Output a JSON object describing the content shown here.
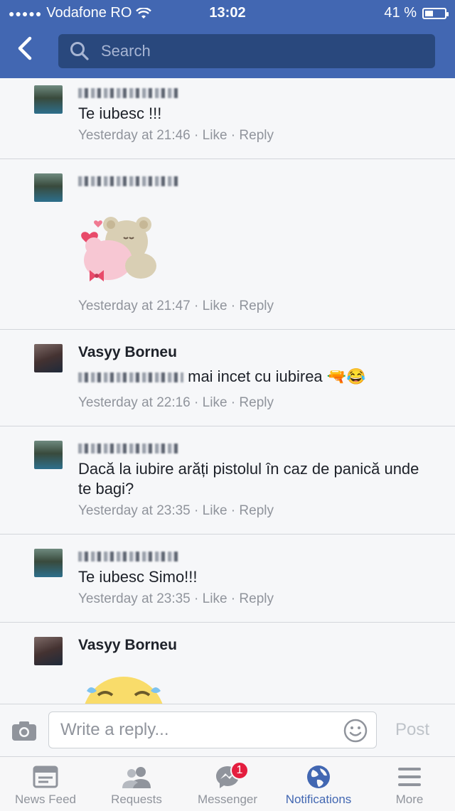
{
  "status": {
    "carrier": "Vodafone RO",
    "time": "13:02",
    "battery": "41 %",
    "battery_level": 0.41
  },
  "header": {
    "search_placeholder": "Search"
  },
  "comments": [
    {
      "author": "",
      "text": "Te iubesc !!!",
      "time": "Yesterday at 21:46",
      "like": "Like",
      "reply": "Reply"
    },
    {
      "author": "",
      "text": "",
      "time": "Yesterday at 21:47",
      "like": "Like",
      "reply": "Reply"
    },
    {
      "author": "Vasyy Borneu",
      "mention": "",
      "text": "mai incet cu iubirea",
      "emojis": "🔫😂",
      "time": "Yesterday at 22:16",
      "like": "Like",
      "reply": "Reply"
    },
    {
      "author": "",
      "text": "Dacă la iubire arăți pistolul în caz de panică unde te bagi?",
      "time": "Yesterday at 23:35",
      "like": "Like",
      "reply": "Reply"
    },
    {
      "author": "",
      "text": "Te iubesc Simo!!!",
      "time": "Yesterday at 23:35",
      "like": "Like",
      "reply": "Reply"
    },
    {
      "author": "Vasyy Borneu"
    }
  ],
  "reply_bar": {
    "placeholder": "Write a reply...",
    "post_label": "Post"
  },
  "tabs": [
    {
      "label": "News Feed",
      "icon": "news-feed-icon"
    },
    {
      "label": "Requests",
      "icon": "requests-icon"
    },
    {
      "label": "Messenger",
      "icon": "messenger-icon",
      "badge": "1"
    },
    {
      "label": "Notifications",
      "icon": "globe-icon",
      "active": true
    },
    {
      "label": "More",
      "icon": "menu-icon"
    }
  ],
  "colors": {
    "brand": "#4267b2",
    "badge": "#e41e3f",
    "meta": "#90949c"
  }
}
